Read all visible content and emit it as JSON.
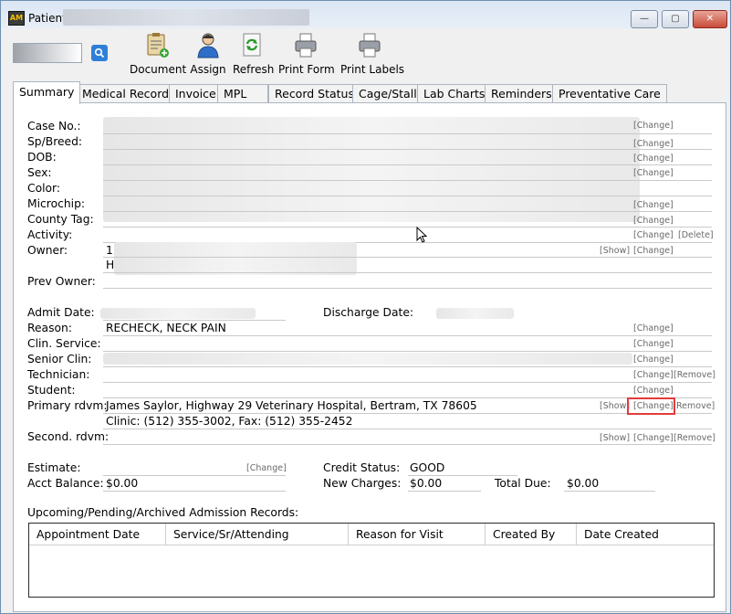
{
  "window": {
    "title": "Patient",
    "controls": {
      "minimize": "—",
      "maximize": "▢",
      "close": "✕"
    }
  },
  "toolbar": {
    "items": [
      {
        "label": "Document",
        "icon": "document-icon"
      },
      {
        "label": "Assign",
        "icon": "user-icon"
      },
      {
        "label": "Refresh",
        "icon": "refresh-icon"
      },
      {
        "label": "Print Form",
        "icon": "printer-icon"
      },
      {
        "label": "Print Labels",
        "icon": "printer-icon"
      }
    ],
    "search_icon": "search-icon"
  },
  "tabs": [
    "Summary",
    "Medical Record",
    "Invoice",
    "MPL",
    "Record Status",
    "Cage/Stall",
    "Lab Charts",
    "Reminders",
    "Preventative Care"
  ],
  "summary": {
    "case_no": "Case No.:",
    "sp_breed": "Sp/Breed:",
    "dob": "DOB:",
    "sex": "Sex:",
    "color": "Color:",
    "microchip": "Microchip:",
    "county_tag": "County Tag:",
    "activity": "Activity:",
    "owner": "Owner:",
    "owner_line1_prefix": "1",
    "owner_line2_prefix": "H",
    "prev_owner": "Prev Owner:",
    "admit_date": "Admit Date:",
    "discharge_date": "Discharge Date:",
    "reason_label": "Reason:",
    "reason_value": "RECHECK, NECK PAIN",
    "clin_service": "Clin. Service:",
    "senior_clin": "Senior Clin:",
    "technician": "Technician:",
    "student": "Student:",
    "primary_rdvm_label": "Primary rdvm:",
    "primary_rdvm_line1": "James Saylor, Highway 29 Veterinary Hospital, Bertram, TX 78605",
    "primary_rdvm_line2": "Clinic: (512) 355-3002, Fax: (512) 355-2452",
    "second_rdvm": "Second. rdvm:",
    "estimate": "Estimate:",
    "acct_balance_label": "Acct Balance:",
    "acct_balance_value": "$0.00",
    "credit_status_label": "Credit Status:",
    "credit_status_value": "GOOD",
    "new_charges_label": "New Charges:",
    "new_charges_value": "$0.00",
    "total_due_label": "Total Due:",
    "total_due_value": "$0.00"
  },
  "links": {
    "change": "[Change]",
    "delete": "[Delete]",
    "show": "[Show]",
    "remove": "[Remove]",
    "remove_clipped": "Remove]"
  },
  "admissions": {
    "title": "Upcoming/Pending/Archived Admission Records:",
    "columns": [
      "Appointment Date",
      "Service/Sr/Attending",
      "Reason for Visit",
      "Created By",
      "Date Created"
    ]
  }
}
